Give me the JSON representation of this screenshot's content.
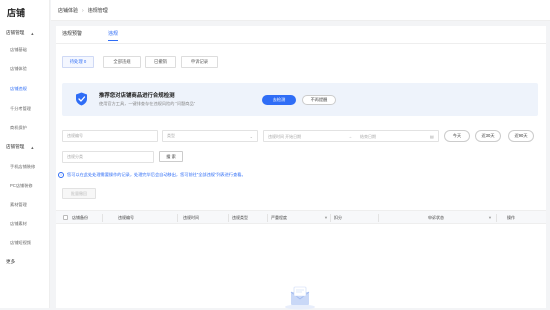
{
  "sidebar": {
    "brand": "店铺",
    "groups": [
      {
        "label": "店铺管理",
        "chevron": "chevron-up-icon"
      },
      {
        "label": "店铺管理",
        "chevron": "chevron-up-icon"
      }
    ],
    "group1_items": [
      "店铺基础",
      "店铺体验",
      "店铺违规",
      "千分考管理",
      "商机保护"
    ],
    "group2_items": [
      "手机店铺装修",
      "PC店铺装修",
      "素材管理",
      "店铺素材",
      "店铺短视频"
    ],
    "more": "更多",
    "active_item": "店铺违规"
  },
  "breadcrumb": {
    "root": "店铺体验",
    "current": "违规管理"
  },
  "tabs": [
    "违规预警",
    "违规"
  ],
  "active_tab": "违规",
  "segments": [
    "待处理 0",
    "全部违规",
    "已撤销",
    "申诉记录"
  ],
  "active_segment": "待处理 0",
  "banner": {
    "title": "推荐您对店铺商品进行合规检测",
    "subtitle": "使用官方工具，一键排查存在违规风险的 “问题商品”",
    "primary_button": "去检测",
    "secondary_button": "不再提醒"
  },
  "filters": {
    "field1_placeholder": "违规编号",
    "field2_placeholder": "类型",
    "date_start_placeholder": "违规时间  开始日期",
    "date_end_placeholder": "结束日期",
    "quick_ranges": [
      "今天",
      "近30天",
      "近90天"
    ],
    "field3_placeholder": "违规分类",
    "search_button": "搜 索"
  },
  "notice": "您可以在此处处理需要操作的记录，处理完毕后会自动移出，您可前往“全部违规”列表进行查看。",
  "batch_button": "批量撤回",
  "table": {
    "columns": [
      "店铺备份",
      "违规编号",
      "违规时间",
      "违规类型",
      "严重程度",
      "扣分",
      "申诉状态",
      "操作"
    ]
  },
  "colors": {
    "accent": "#2f6df6",
    "banner_bg": "#eef3fb"
  }
}
